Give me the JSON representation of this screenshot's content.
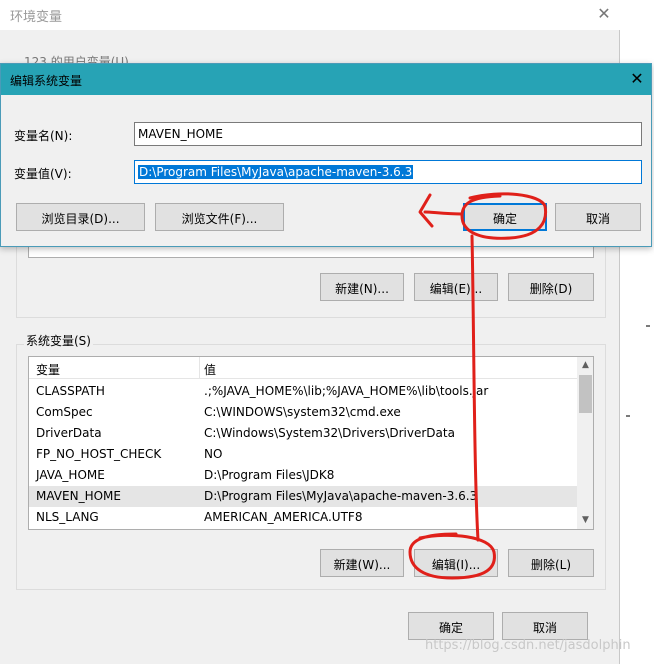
{
  "env_window": {
    "title": "环境变量",
    "user_group_label": "123 的用户变量(U)",
    "user_buttons": {
      "new": "新建(N)...",
      "edit": "编辑(E)...",
      "delete": "删除(D)"
    },
    "system_group_label": "系统变量(S)",
    "system_table": {
      "columns": [
        "变量",
        "值"
      ],
      "rows": [
        {
          "name": "CLASSPATH",
          "value": ".;%JAVA_HOME%\\lib;%JAVA_HOME%\\lib\\tools.jar"
        },
        {
          "name": "ComSpec",
          "value": "C:\\WINDOWS\\system32\\cmd.exe"
        },
        {
          "name": "DriverData",
          "value": "C:\\Windows\\System32\\Drivers\\DriverData"
        },
        {
          "name": "FP_NO_HOST_CHECK",
          "value": "NO"
        },
        {
          "name": "JAVA_HOME",
          "value": "D:\\Program Files\\JDK8"
        },
        {
          "name": "MAVEN_HOME",
          "value": "D:\\Program Files\\MyJava\\apache-maven-3.6.3"
        },
        {
          "name": "NLS_LANG",
          "value": "AMERICAN_AMERICA.UTF8"
        }
      ],
      "selected_index": 5
    },
    "system_buttons": {
      "new": "新建(W)...",
      "edit": "编辑(I)...",
      "delete": "删除(L)"
    },
    "ok": "确定",
    "cancel": "取消"
  },
  "edit_dialog": {
    "title": "编辑系统变量",
    "name_label": "变量名(N):",
    "name_value": "MAVEN_HOME",
    "value_label": "变量值(V):",
    "value_value": "D:\\Program Files\\MyJava\\apache-maven-3.6.3",
    "browse_dir": "浏览目录(D)...",
    "browse_file": "浏览文件(F)...",
    "ok": "确定",
    "cancel": "取消"
  },
  "watermark": "https://blog.csdn.net/jasdolphin",
  "colors": {
    "titlebar_active": "#27a3b5",
    "selection": "#0078d7",
    "annotation": "#e0201a"
  },
  "icons": {
    "close": "close-icon",
    "scroll_up": "scroll-up-icon",
    "scroll_down": "scroll-down-icon"
  }
}
